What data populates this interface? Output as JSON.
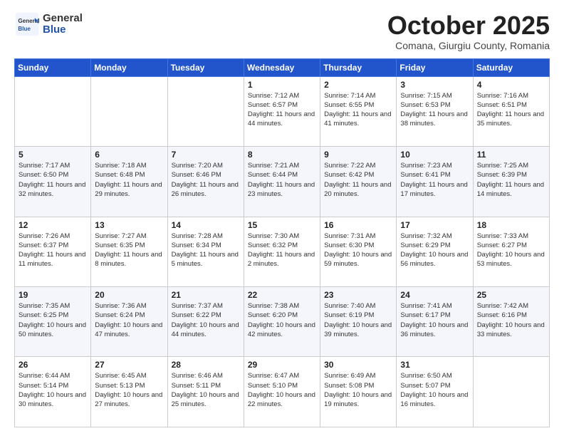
{
  "header": {
    "logo_general": "General",
    "logo_blue": "Blue",
    "month_title": "October 2025",
    "location": "Comana, Giurgiu County, Romania"
  },
  "days_of_week": [
    "Sunday",
    "Monday",
    "Tuesday",
    "Wednesday",
    "Thursday",
    "Friday",
    "Saturday"
  ],
  "weeks": [
    [
      {
        "num": "",
        "info": ""
      },
      {
        "num": "",
        "info": ""
      },
      {
        "num": "",
        "info": ""
      },
      {
        "num": "1",
        "info": "Sunrise: 7:12 AM\nSunset: 6:57 PM\nDaylight: 11 hours and 44 minutes."
      },
      {
        "num": "2",
        "info": "Sunrise: 7:14 AM\nSunset: 6:55 PM\nDaylight: 11 hours and 41 minutes."
      },
      {
        "num": "3",
        "info": "Sunrise: 7:15 AM\nSunset: 6:53 PM\nDaylight: 11 hours and 38 minutes."
      },
      {
        "num": "4",
        "info": "Sunrise: 7:16 AM\nSunset: 6:51 PM\nDaylight: 11 hours and 35 minutes."
      }
    ],
    [
      {
        "num": "5",
        "info": "Sunrise: 7:17 AM\nSunset: 6:50 PM\nDaylight: 11 hours and 32 minutes."
      },
      {
        "num": "6",
        "info": "Sunrise: 7:18 AM\nSunset: 6:48 PM\nDaylight: 11 hours and 29 minutes."
      },
      {
        "num": "7",
        "info": "Sunrise: 7:20 AM\nSunset: 6:46 PM\nDaylight: 11 hours and 26 minutes."
      },
      {
        "num": "8",
        "info": "Sunrise: 7:21 AM\nSunset: 6:44 PM\nDaylight: 11 hours and 23 minutes."
      },
      {
        "num": "9",
        "info": "Sunrise: 7:22 AM\nSunset: 6:42 PM\nDaylight: 11 hours and 20 minutes."
      },
      {
        "num": "10",
        "info": "Sunrise: 7:23 AM\nSunset: 6:41 PM\nDaylight: 11 hours and 17 minutes."
      },
      {
        "num": "11",
        "info": "Sunrise: 7:25 AM\nSunset: 6:39 PM\nDaylight: 11 hours and 14 minutes."
      }
    ],
    [
      {
        "num": "12",
        "info": "Sunrise: 7:26 AM\nSunset: 6:37 PM\nDaylight: 11 hours and 11 minutes."
      },
      {
        "num": "13",
        "info": "Sunrise: 7:27 AM\nSunset: 6:35 PM\nDaylight: 11 hours and 8 minutes."
      },
      {
        "num": "14",
        "info": "Sunrise: 7:28 AM\nSunset: 6:34 PM\nDaylight: 11 hours and 5 minutes."
      },
      {
        "num": "15",
        "info": "Sunrise: 7:30 AM\nSunset: 6:32 PM\nDaylight: 11 hours and 2 minutes."
      },
      {
        "num": "16",
        "info": "Sunrise: 7:31 AM\nSunset: 6:30 PM\nDaylight: 10 hours and 59 minutes."
      },
      {
        "num": "17",
        "info": "Sunrise: 7:32 AM\nSunset: 6:29 PM\nDaylight: 10 hours and 56 minutes."
      },
      {
        "num": "18",
        "info": "Sunrise: 7:33 AM\nSunset: 6:27 PM\nDaylight: 10 hours and 53 minutes."
      }
    ],
    [
      {
        "num": "19",
        "info": "Sunrise: 7:35 AM\nSunset: 6:25 PM\nDaylight: 10 hours and 50 minutes."
      },
      {
        "num": "20",
        "info": "Sunrise: 7:36 AM\nSunset: 6:24 PM\nDaylight: 10 hours and 47 minutes."
      },
      {
        "num": "21",
        "info": "Sunrise: 7:37 AM\nSunset: 6:22 PM\nDaylight: 10 hours and 44 minutes."
      },
      {
        "num": "22",
        "info": "Sunrise: 7:38 AM\nSunset: 6:20 PM\nDaylight: 10 hours and 42 minutes."
      },
      {
        "num": "23",
        "info": "Sunrise: 7:40 AM\nSunset: 6:19 PM\nDaylight: 10 hours and 39 minutes."
      },
      {
        "num": "24",
        "info": "Sunrise: 7:41 AM\nSunset: 6:17 PM\nDaylight: 10 hours and 36 minutes."
      },
      {
        "num": "25",
        "info": "Sunrise: 7:42 AM\nSunset: 6:16 PM\nDaylight: 10 hours and 33 minutes."
      }
    ],
    [
      {
        "num": "26",
        "info": "Sunrise: 6:44 AM\nSunset: 5:14 PM\nDaylight: 10 hours and 30 minutes."
      },
      {
        "num": "27",
        "info": "Sunrise: 6:45 AM\nSunset: 5:13 PM\nDaylight: 10 hours and 27 minutes."
      },
      {
        "num": "28",
        "info": "Sunrise: 6:46 AM\nSunset: 5:11 PM\nDaylight: 10 hours and 25 minutes."
      },
      {
        "num": "29",
        "info": "Sunrise: 6:47 AM\nSunset: 5:10 PM\nDaylight: 10 hours and 22 minutes."
      },
      {
        "num": "30",
        "info": "Sunrise: 6:49 AM\nSunset: 5:08 PM\nDaylight: 10 hours and 19 minutes."
      },
      {
        "num": "31",
        "info": "Sunrise: 6:50 AM\nSunset: 5:07 PM\nDaylight: 10 hours and 16 minutes."
      },
      {
        "num": "",
        "info": ""
      }
    ]
  ]
}
